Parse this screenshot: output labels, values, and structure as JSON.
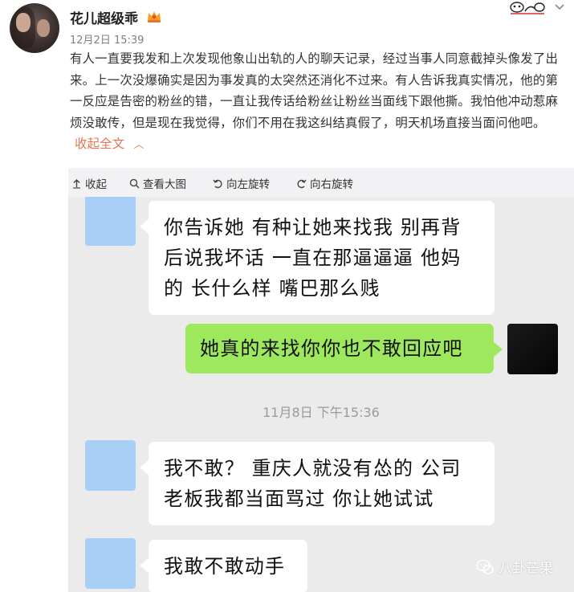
{
  "post": {
    "username": "花儿超级乖",
    "time": "12月2日 15:39",
    "text": "有人一直要我发和上次发现他象山出轨的人的聊天记录，经过当事人同意截掉头像发了出来。上一次没爆确实是因为事发真的太突然还消化不过来。有人告诉我真实情况，他的第一反应是告密的粉丝的错，一直让我传话给粉丝让粉丝当面线下跟他撕。我怕他冲动惹麻烦没敢传，但是现在我觉得，你们不用在我这纠结真假了，明天机场直接当面问他吧。",
    "collapse_label": "收起全文",
    "collapse_caret": "^"
  },
  "toolbar": {
    "collapse": "收起",
    "view_large": "查看大图",
    "rotate_left": "向左旋转",
    "rotate_right": "向右旋转"
  },
  "chat": {
    "messages": [
      {
        "side": "left",
        "text": "你告诉她 有种让她来找我 别再背后说我坏话 一直在那逼逼逼 他妈的 长什么样 嘴巴那么贱"
      },
      {
        "side": "right",
        "text": "她真的来找你你也不敢回应吧"
      },
      {
        "side": "left",
        "text": "我不敢？ 重庆人就没有怂的 公司老板我都当面骂过 你让她试试"
      },
      {
        "side": "left",
        "text": "我敢不敢动手"
      }
    ],
    "timestamp": "11月8日 下午15:36"
  },
  "watermark": "八卦芒果",
  "colors": {
    "accent": "#eb7350",
    "chat_bg": "#ebebeb",
    "bubble_right": "#9ee85e",
    "avatar_left": "#a9cff7",
    "toolbar_bg": "#f2f2f5"
  }
}
